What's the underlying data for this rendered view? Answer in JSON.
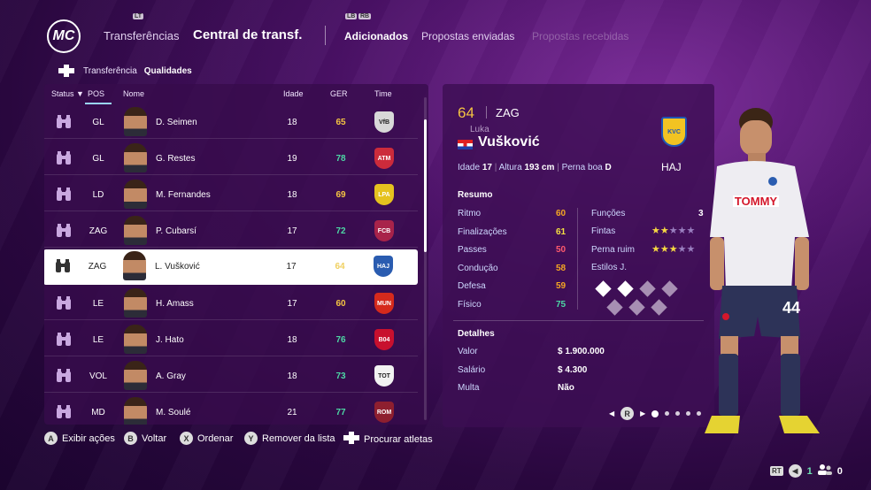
{
  "header": {
    "logo_text": "MC",
    "lb_hint": "LB",
    "rb_hint": "RB",
    "l2_hint": "LT",
    "tabs": [
      {
        "label": "Transferências"
      },
      {
        "label": "Central de transf."
      },
      {
        "label": "Adicionados"
      },
      {
        "label": "Propostas enviadas"
      },
      {
        "label": "Propostas recebidas"
      }
    ]
  },
  "subnav": {
    "items": [
      "Transferência",
      "Qualidades"
    ]
  },
  "list": {
    "columns": {
      "status": "Status",
      "pos": "POS",
      "name": "Nome",
      "age": "Idade",
      "ger": "GER",
      "team": "Time"
    },
    "rows": [
      {
        "pos": "GL",
        "name": "D. Seimen",
        "age": "18",
        "ger": "65",
        "ger_color": "#f5c542",
        "crest_color": "#d8d8d8",
        "crest": "VfB"
      },
      {
        "pos": "GL",
        "name": "G. Restes",
        "age": "19",
        "ger": "78",
        "ger_color": "#4dd8a5",
        "crest_color": "#cc2b3b",
        "crest": "ATM"
      },
      {
        "pos": "LD",
        "name": "M. Fernandes",
        "age": "18",
        "ger": "69",
        "ger_color": "#f5c542",
        "crest_color": "#e5c21f",
        "crest": "LPA"
      },
      {
        "pos": "ZAG",
        "name": "P. Cubarsí",
        "age": "17",
        "ger": "72",
        "ger_color": "#4dd8a5",
        "crest_color": "#a8234a",
        "crest": "FCB"
      },
      {
        "pos": "ZAG",
        "name": "L. Vušković",
        "age": "17",
        "ger": "64",
        "ger_color": "#f0d060",
        "crest_color": "#2a5cb0",
        "crest": "HAJ",
        "selected": true
      },
      {
        "pos": "LE",
        "name": "H. Amass",
        "age": "17",
        "ger": "60",
        "ger_color": "#f5c542",
        "crest_color": "#d52a1c",
        "crest": "MUN"
      },
      {
        "pos": "LE",
        "name": "J. Hato",
        "age": "18",
        "ger": "76",
        "ger_color": "#4dd8a5",
        "crest_color": "#c8102e",
        "crest": "B04"
      },
      {
        "pos": "VOL",
        "name": "A. Gray",
        "age": "18",
        "ger": "73",
        "ger_color": "#4dd8a5",
        "crest_color": "#f2f2f2",
        "crest": "TOT"
      },
      {
        "pos": "MD",
        "name": "M. Soulé",
        "age": "21",
        "ger": "77",
        "ger_color": "#4dd8a5",
        "crest_color": "#8e1f2f",
        "crest": "ROM"
      }
    ]
  },
  "player": {
    "overall": "64",
    "position": "ZAG",
    "first_name": "Luka",
    "last_name": "Vušković",
    "club_abbr": "HAJ",
    "club_crest_text": "KVC",
    "age_label": "Idade",
    "age": "17",
    "height_label": "Altura",
    "height": "193 cm",
    "foot_label": "Perna boa",
    "foot": "D",
    "shirt_number": "44",
    "sponsor": "TOMMY"
  },
  "summary": {
    "title": "Resumo",
    "stats": [
      {
        "label": "Ritmo",
        "value": "60",
        "color": "#f5a623"
      },
      {
        "label": "Finalizações",
        "value": "61",
        "color": "#f5e042"
      },
      {
        "label": "Passes",
        "value": "50",
        "color": "#ff5a6e"
      },
      {
        "label": "Condução",
        "value": "58",
        "color": "#f5a623"
      },
      {
        "label": "Defesa",
        "value": "59",
        "color": "#f5a623"
      },
      {
        "label": "Físico",
        "value": "75",
        "color": "#4dd8a5"
      }
    ],
    "functions_label": "Funções",
    "functions_value": "3",
    "skills_label": "Fintas",
    "skills_stars": 2,
    "weakfoot_label": "Perna ruim",
    "weakfoot_stars": 3,
    "styles_label": "Estilos J."
  },
  "details": {
    "title": "Detalhes",
    "rows": [
      {
        "label": "Valor",
        "value": "$ 1.900.000"
      },
      {
        "label": "Salário",
        "value": "$ 4.300"
      },
      {
        "label": "Multa",
        "value": "Não"
      }
    ]
  },
  "pager": {
    "button": "R",
    "pages": 5,
    "active": 0
  },
  "bottom_actions": [
    {
      "button": "A",
      "label": "Exibir ações"
    },
    {
      "button": "B",
      "label": "Voltar"
    },
    {
      "button": "X",
      "label": "Ordenar"
    },
    {
      "button": "Y",
      "label": "Remover da lista"
    },
    {
      "button": "+",
      "label": "Procurar atletas"
    }
  ],
  "status_bar": {
    "rt": "RT",
    "count1": "1",
    "count2": "0"
  }
}
